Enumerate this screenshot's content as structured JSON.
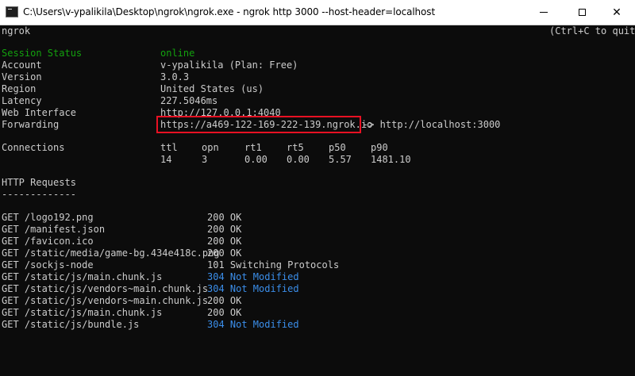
{
  "window": {
    "title": "C:\\Users\\v-ypalikila\\Desktop\\ngrok\\ngrok.exe - ngrok  http 3000 --host-header=localhost",
    "minimize": "—",
    "maximize": "☐",
    "close": "✕"
  },
  "header": {
    "app_name": "ngrok",
    "quit_hint": "(Ctrl+C to quit)"
  },
  "status": {
    "session_label": "Session Status",
    "session_value": "online",
    "rows": [
      {
        "label": "Account",
        "value": "v-ypalikila (Plan: Free)"
      },
      {
        "label": "Version",
        "value": "3.0.3"
      },
      {
        "label": "Region",
        "value": "United States (us)"
      },
      {
        "label": "Latency",
        "value": "227.5046ms"
      },
      {
        "label": "Web Interface",
        "value": "http://127.0.0.1:4040"
      }
    ],
    "forwarding_label": "Forwarding",
    "forwarding_url": "https://a469-122-169-222-139.ngrok.io",
    "forwarding_target": "-> http://localhost:3000"
  },
  "connections": {
    "label": "Connections",
    "headers": [
      "ttl",
      "opn",
      "rt1",
      "rt5",
      "p50",
      "p90"
    ],
    "values": [
      "14",
      "3",
      "0.00",
      "0.00",
      "5.57",
      "1481.10"
    ]
  },
  "http_requests": {
    "title": "HTTP Requests",
    "underline": "-------------",
    "items": [
      {
        "request": "GET /logo192.png",
        "status": "200 OK",
        "highlight": false
      },
      {
        "request": "GET /manifest.json",
        "status": "200 OK",
        "highlight": false
      },
      {
        "request": "GET /favicon.ico",
        "status": "200 OK",
        "highlight": false
      },
      {
        "request": "GET /static/media/game-bg.434e418c.png",
        "status": "200 OK",
        "highlight": false
      },
      {
        "request": "GET /sockjs-node",
        "status": "101 Switching Protocols",
        "highlight": false
      },
      {
        "request": "GET /static/js/main.chunk.js",
        "status": "304 Not Modified",
        "highlight": true
      },
      {
        "request": "GET /static/js/vendors~main.chunk.js",
        "status": "304 Not Modified",
        "highlight": true
      },
      {
        "request": "GET /static/js/vendors~main.chunk.js",
        "status": "200 OK",
        "highlight": false
      },
      {
        "request": "GET /static/js/main.chunk.js",
        "status": "200 OK",
        "highlight": false
      },
      {
        "request": "GET /static/js/bundle.js",
        "status": "304 Not Modified",
        "highlight": true
      }
    ]
  },
  "colors": {
    "background": "#0c0c0c",
    "text": "#cccccc",
    "online": "#13a10e",
    "not_modified": "#3b8eea",
    "highlight_box": "#e81123"
  }
}
